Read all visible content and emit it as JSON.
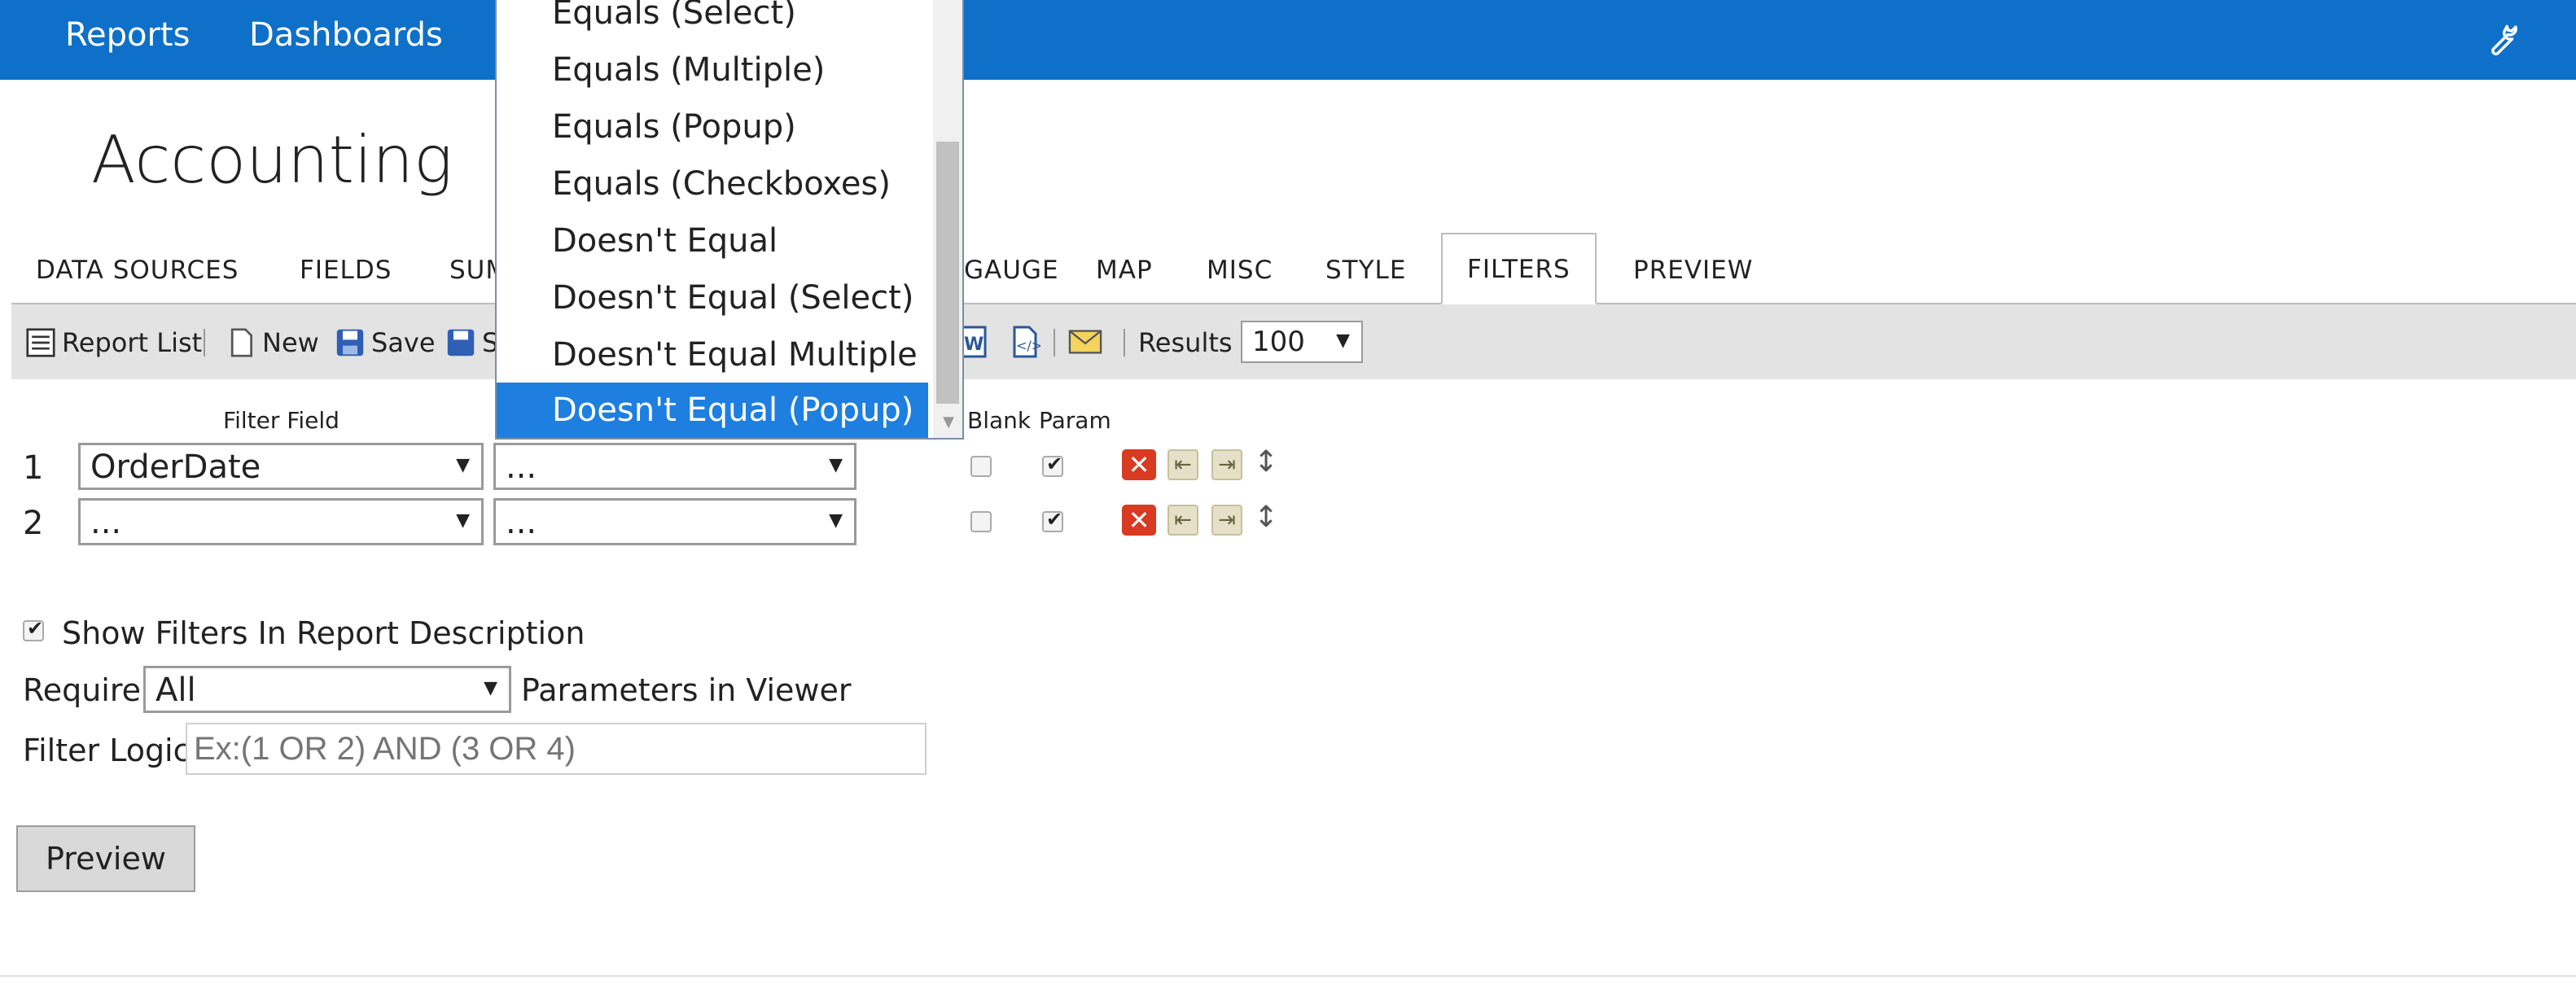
{
  "topbar": {
    "nav": [
      "Reports",
      "Dashboards"
    ],
    "color": "#0e70c8"
  },
  "page": {
    "title": "Accounting"
  },
  "tabs": {
    "items": [
      "DATA SOURCES",
      "FIELDS",
      "SUM",
      "GAUGE",
      "MAP",
      "MISC",
      "STYLE",
      "FILTERS",
      "PREVIEW"
    ],
    "active": "FILTERS"
  },
  "toolbar": {
    "report_list": "Report List",
    "new": "New",
    "save": "Save",
    "save_as_partial": "S",
    "results_label": "Results",
    "results_value": "100"
  },
  "filters": {
    "headers": {
      "filter_field": "Filter Field",
      "blank": "Blank",
      "param": "Param"
    },
    "rows": [
      {
        "num": "1",
        "field": "OrderDate",
        "operator": "...",
        "blank": false,
        "param": true
      },
      {
        "num": "2",
        "field": "...",
        "operator": "...",
        "blank": false,
        "param": true
      }
    ]
  },
  "options": {
    "show_filters_label": "Show Filters In Report Description",
    "show_filters_checked": true,
    "require_label": "Require",
    "require_value": "All",
    "parameters_label": "Parameters in Viewer",
    "filter_logic_label": "Filter Logic",
    "filter_logic_placeholder": "Ex:(1 OR 2) AND (3 OR 4)"
  },
  "preview_button": "Preview",
  "operator_dropdown": {
    "items": [
      "Equals (Select)",
      "Equals (Multiple)",
      "Equals (Popup)",
      "Equals (Checkboxes)",
      "Doesn't Equal",
      "Doesn't Equal (Select)",
      "Doesn't Equal Multiple",
      "Doesn't Equal (Popup)"
    ],
    "selected": "Doesn't Equal (Popup)",
    "selected_color": "#1e7fe0"
  }
}
